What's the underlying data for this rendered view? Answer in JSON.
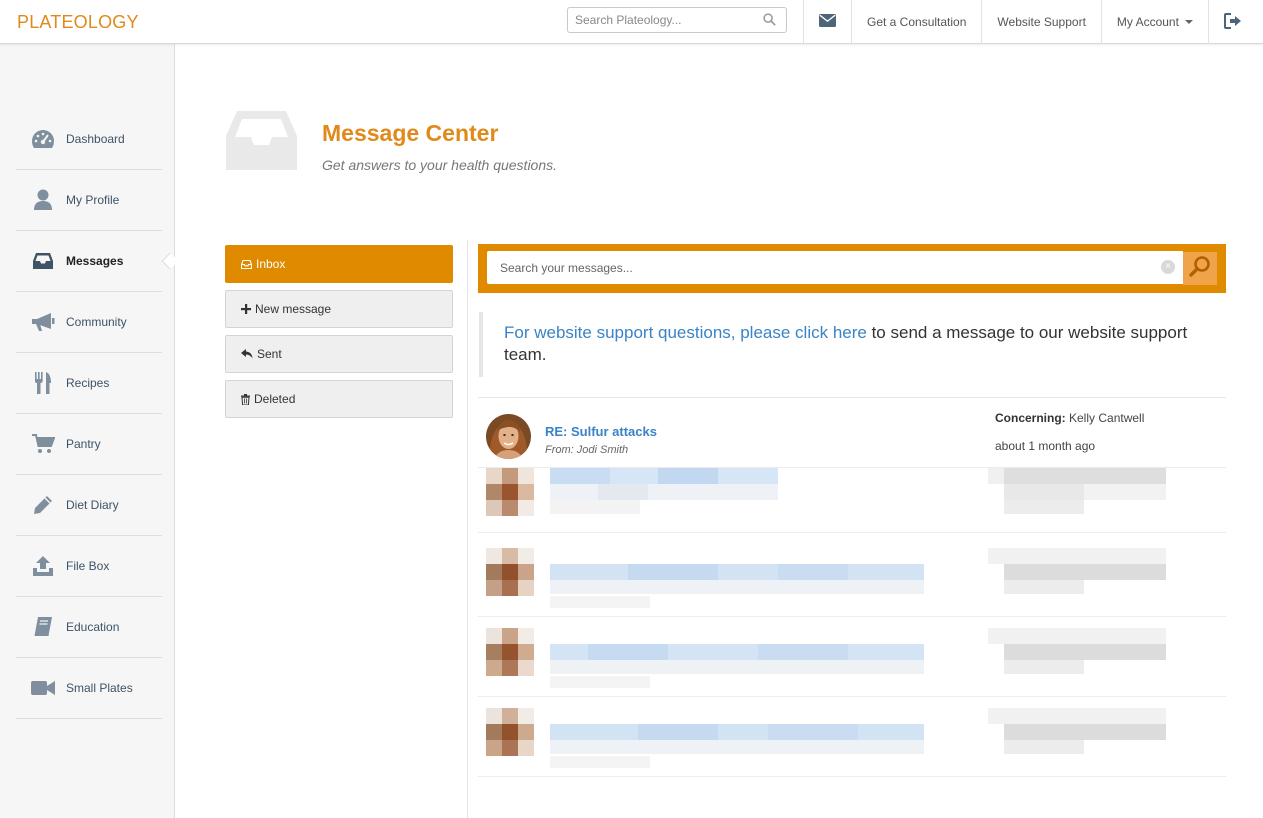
{
  "topbar": {
    "logo": "PLATEOLOGY",
    "search_placeholder": "Search Plateology...",
    "nav": {
      "consultation": "Get a Consultation",
      "support": "Website Support",
      "account": "My Account"
    }
  },
  "sidebar": {
    "items": [
      {
        "label": "Dashboard",
        "icon": "dashboard-icon"
      },
      {
        "label": "My Profile",
        "icon": "user-icon"
      },
      {
        "label": "Messages",
        "icon": "inbox-icon",
        "active": true
      },
      {
        "label": "Community",
        "icon": "megaphone-icon"
      },
      {
        "label": "Recipes",
        "icon": "utensils-icon"
      },
      {
        "label": "Pantry",
        "icon": "cart-icon"
      },
      {
        "label": "Diet Diary",
        "icon": "pencil-icon"
      },
      {
        "label": "File Box",
        "icon": "upload-icon"
      },
      {
        "label": "Education",
        "icon": "book-icon"
      },
      {
        "label": "Small Plates",
        "icon": "video-camera-icon"
      }
    ]
  },
  "header": {
    "title": "Message Center",
    "subtitle": "Get answers to your health questions."
  },
  "folders": {
    "inbox": "Inbox",
    "new_message": "New message",
    "sent": "Sent",
    "deleted": "Deleted"
  },
  "message_search": {
    "placeholder": "Search your messages..."
  },
  "notice": {
    "link_text": "For website support questions, please click here",
    "rest_text": " to send a message to our website support team."
  },
  "messages": [
    {
      "subject": "RE: Sulfur attacks",
      "from": "From: Jodi Smith",
      "concerning_label": "Concerning:",
      "concerning_value": " Kelly Cantwell",
      "time": "about 1 month ago"
    }
  ],
  "colors": {
    "accent": "#e08a00",
    "link": "#3a83c6"
  }
}
